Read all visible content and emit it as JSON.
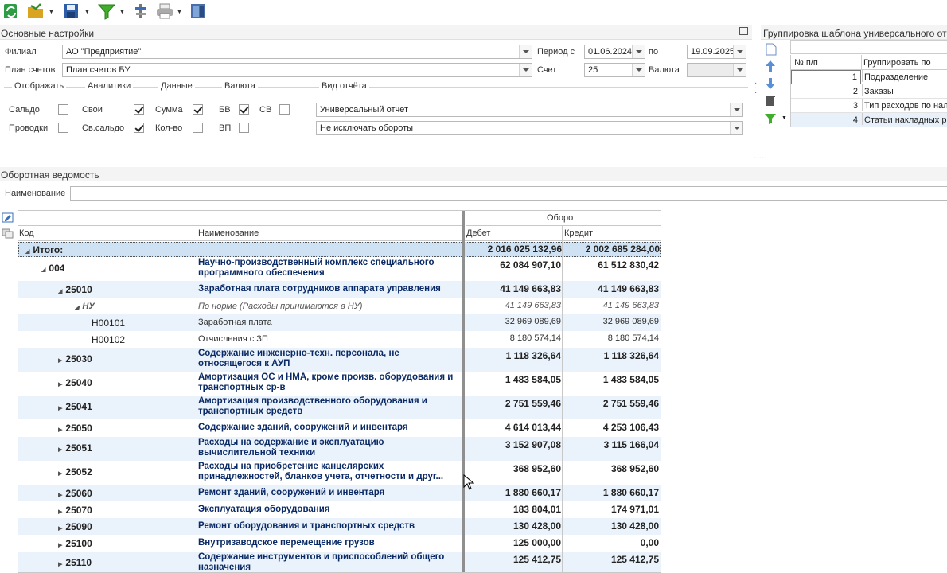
{
  "toolbar": {
    "buttons": [
      "refresh-icon",
      "open-folder-icon",
      "save-icon",
      "filter-icon",
      "tools-icon",
      "print-icon",
      "exit-icon"
    ]
  },
  "settings": {
    "title": "Основные настройки",
    "filial_label": "Филиал",
    "filial_value": "АО \"Предприятие\"",
    "plan_label": "План счетов",
    "plan_value": "План счетов БУ",
    "period_label": "Период с",
    "period_from": "01.06.2024",
    "period_to_label": "по",
    "period_to": "19.09.2025",
    "account_label": "Счет",
    "account_value": "25",
    "currency_label": "Валюта",
    "currency_value": "",
    "groups": {
      "display": "Отображать",
      "analytics": "Аналитики",
      "data": "Данные",
      "currency": "Валюта",
      "report_type": "Вид отчёта"
    },
    "checkboxes": {
      "saldo": {
        "label": "Сальдо",
        "checked": false
      },
      "provodki": {
        "label": "Проводки",
        "checked": false
      },
      "svoi": {
        "label": "Свои",
        "checked": true
      },
      "sv_saldo": {
        "label": "Св.сальдо",
        "checked": true
      },
      "summa": {
        "label": "Сумма",
        "checked": true
      },
      "kol_vo": {
        "label": "Кол-во",
        "checked": false
      },
      "bv": {
        "label": "БВ",
        "checked": true
      },
      "sv": {
        "label": "СВ",
        "checked": false
      },
      "vp": {
        "label": "ВП",
        "checked": false
      }
    },
    "report_type_value": "Универсальный отчет",
    "turnover_mode_value": "Не исключать обороты"
  },
  "grouping": {
    "title": "Группировка шаблона универсального отч",
    "col_num": "№ п/п",
    "col_group": "Группировать по",
    "rows": [
      {
        "n": "1",
        "g": "Подразделение"
      },
      {
        "n": "2",
        "g": "Заказы"
      },
      {
        "n": "3",
        "g": "Тип расходов по нал"
      },
      {
        "n": "4",
        "g": "Статьи накладных р"
      }
    ]
  },
  "statement": {
    "title": "Оборотная ведомость",
    "search_label": "Наименование",
    "search_value": "",
    "col_code": "Код",
    "col_name": "Наименование",
    "col_turnover": "Оборот",
    "col_debit": "Дебет",
    "col_credit": "Кредит",
    "rows": [
      {
        "code": "Итого:",
        "name": "",
        "debit": "2 016 025 132,96",
        "credit": "2 002 685 284,00",
        "level": 0,
        "kind": "total"
      },
      {
        "code": "004",
        "name": "Научно-производственный комплекс специального программного обеспечения",
        "debit": "62 084 907,10",
        "credit": "61 512 830,42",
        "level": 1,
        "kind": "open"
      },
      {
        "code": "25010",
        "name": "Заработная плата сотрудников аппарата управления",
        "debit": "41 149 663,83",
        "credit": "41 149 663,83",
        "level": 2,
        "kind": "open"
      },
      {
        "code": "НУ",
        "name": "По норме (Расходы принимаются в НУ)",
        "debit": "41 149 663,83",
        "credit": "41 149 663,83",
        "level": 3,
        "kind": "italic"
      },
      {
        "code": "Н00101",
        "name": "Заработная плата",
        "debit": "32 969 089,69",
        "credit": "32 969 089,69",
        "level": 4,
        "kind": "plain"
      },
      {
        "code": "Н00102",
        "name": "Отчисления с ЗП",
        "debit": "8 180 574,14",
        "credit": "8 180 574,14",
        "level": 4,
        "kind": "plain"
      },
      {
        "code": "25030",
        "name": "Содержание инженерно-техн. персонала, не относящегося к АУП",
        "debit": "1 118 326,64",
        "credit": "1 118 326,64",
        "level": 2,
        "kind": "closed"
      },
      {
        "code": "25040",
        "name": "Амортизация ОС и НМА, кроме произв. оборудования и транспортных ср-в",
        "debit": "1 483 584,05",
        "credit": "1 483 584,05",
        "level": 2,
        "kind": "closed"
      },
      {
        "code": "25041",
        "name": "Амортизация производственного оборудования и транспортных средств",
        "debit": "2 751 559,46",
        "credit": "2 751 559,46",
        "level": 2,
        "kind": "closed"
      },
      {
        "code": "25050",
        "name": "Содержание зданий, сооружений и инвентаря",
        "debit": "4 614 013,44",
        "credit": "4 253 106,43",
        "level": 2,
        "kind": "closed"
      },
      {
        "code": "25051",
        "name": "Расходы на содержание и эксплуатацию вычислительной техники",
        "debit": "3 152 907,08",
        "credit": "3 115 166,04",
        "level": 2,
        "kind": "closed"
      },
      {
        "code": "25052",
        "name": "Расходы на приобретение канцелярских принадлежностей, бланков учета, отчетности и друг...",
        "debit": "368 952,60",
        "credit": "368 952,60",
        "level": 2,
        "kind": "closed"
      },
      {
        "code": "25060",
        "name": "Ремонт зданий, сооружений и инвентаря",
        "debit": "1 880 660,17",
        "credit": "1 880 660,17",
        "level": 2,
        "kind": "closed"
      },
      {
        "code": "25070",
        "name": "Эксплуатация оборудования",
        "debit": "183 804,01",
        "credit": "174 971,01",
        "level": 2,
        "kind": "closed"
      },
      {
        "code": "25090",
        "name": "Ремонт оборудования и транспортных средств",
        "debit": "130 428,00",
        "credit": "130 428,00",
        "level": 2,
        "kind": "closed"
      },
      {
        "code": "25100",
        "name": "Внутризаводское перемещение грузов",
        "debit": "125 000,00",
        "credit": "0,00",
        "level": 2,
        "kind": "closed"
      },
      {
        "code": "25110",
        "name": "Содержание инструментов и приспособлений общего назначения",
        "debit": "125 412,75",
        "credit": "125 412,75",
        "level": 2,
        "kind": "closed"
      }
    ]
  }
}
